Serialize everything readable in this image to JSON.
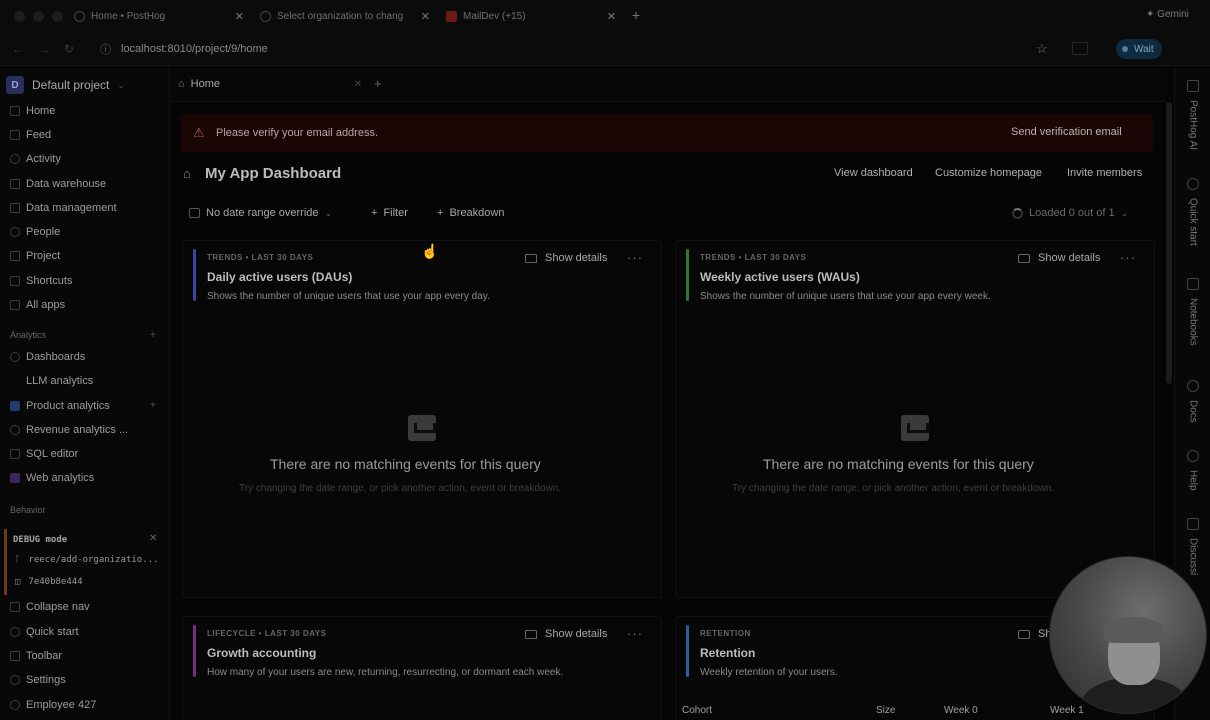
{
  "browser": {
    "tabs": [
      {
        "title": "Home • PostHog",
        "fav": "posthog"
      },
      {
        "title": "Select organization to chang",
        "fav": "globe"
      },
      {
        "title": "MailDev (+15)",
        "fav": "maildev"
      }
    ],
    "new_tab": "+",
    "profile": "Gemini",
    "url": "localhost:8010/project/9/home",
    "wait_label": "Wait"
  },
  "sidebar": {
    "project_initial": "D",
    "project_name": "Default project",
    "nav": [
      {
        "label": "Home",
        "icon": "home-icon"
      },
      {
        "label": "Feed",
        "icon": "feed-icon"
      },
      {
        "label": "Activity",
        "icon": "activity-icon"
      },
      {
        "label": "Data warehouse",
        "icon": "database-icon"
      },
      {
        "label": "Data management",
        "icon": "data-management-icon"
      },
      {
        "label": "People",
        "icon": "people-icon"
      },
      {
        "label": "Project",
        "icon": "project-icon"
      },
      {
        "label": "Shortcuts",
        "icon": "shortcuts-icon"
      },
      {
        "label": "All apps",
        "icon": "apps-icon"
      }
    ],
    "analytics_section": "Analytics",
    "analytics": [
      {
        "label": "Dashboards",
        "icon": "dashboard-icon"
      },
      {
        "label": "LLM analytics",
        "icon": "llm-icon"
      },
      {
        "label": "Product analytics",
        "icon": "product-analytics-icon"
      },
      {
        "label": "Revenue analytics ...",
        "icon": "revenue-icon"
      },
      {
        "label": "SQL editor",
        "icon": "sql-icon"
      },
      {
        "label": "Web analytics",
        "icon": "web-analytics-icon"
      }
    ],
    "behavior_section": "Behavior",
    "debug": {
      "title": "DEBUG mode",
      "branch": "reece/add-organizatio...",
      "commit": "7e40b8e444"
    },
    "bottom": [
      {
        "label": "Collapse nav",
        "icon": "collapse-icon"
      },
      {
        "label": "Quick start",
        "icon": "rocket-icon"
      },
      {
        "label": "Toolbar",
        "icon": "toolbar-icon"
      },
      {
        "label": "Settings",
        "icon": "gear-icon"
      },
      {
        "label": "Employee 427",
        "icon": "user-icon"
      }
    ]
  },
  "scene_tab": {
    "label": "Home"
  },
  "banner": {
    "message": "Please verify your email address.",
    "action": "Send verification email"
  },
  "dashboard": {
    "title": "My App Dashboard",
    "actions": [
      "View dashboard",
      "Customize homepage",
      "Invite members"
    ],
    "date_filter": "No date range override",
    "filter_label": "Filter",
    "breakdown_label": "Breakdown",
    "loaded_status": "Loaded 0 out of 1"
  },
  "cards": [
    {
      "meta": "TRENDS • LAST 30 DAYS",
      "title": "Daily active users (DAUs)",
      "desc": "Shows the number of unique users that use your app every day.",
      "stripe": "#3b47a8",
      "show_details": "Show details",
      "empty_title": "There are no matching events for this query",
      "empty_sub": "Try changing the date range, or pick another action, event or breakdown."
    },
    {
      "meta": "TRENDS • LAST 30 DAYS",
      "title": "Weekly active users (WAUs)",
      "desc": "Shows the number of unique users that use your app every week.",
      "stripe": "#2c7a2c",
      "show_details": "Show details",
      "empty_title": "There are no matching events for this query",
      "empty_sub": "Try changing the date range, or pick another action, event or breakdown."
    },
    {
      "meta": "LIFECYCLE • LAST 30 DAYS",
      "title": "Growth accounting",
      "desc": "How many of your users are new, returning, resurrecting, or dormant each week.",
      "stripe": "#7a2c86",
      "show_details": "Show details"
    },
    {
      "meta": "RETENTION",
      "title": "Retention",
      "desc": "Weekly retention of your users.",
      "stripe": "#2f5e9c",
      "show_details": "Sh",
      "table_headers": [
        "Cohort",
        "Size",
        "Week 0",
        "Week 1"
      ]
    }
  ],
  "right_sidebar": [
    {
      "label": "PostHog AI",
      "icon": "sparkle-icon"
    },
    {
      "label": "Quick start",
      "icon": "rocket-icon"
    },
    {
      "label": "Notebooks",
      "icon": "notebook-icon"
    },
    {
      "label": "Docs",
      "icon": "docs-icon"
    },
    {
      "label": "Help",
      "icon": "help-icon"
    },
    {
      "label": "Discussi",
      "icon": "discussion-icon"
    }
  ]
}
